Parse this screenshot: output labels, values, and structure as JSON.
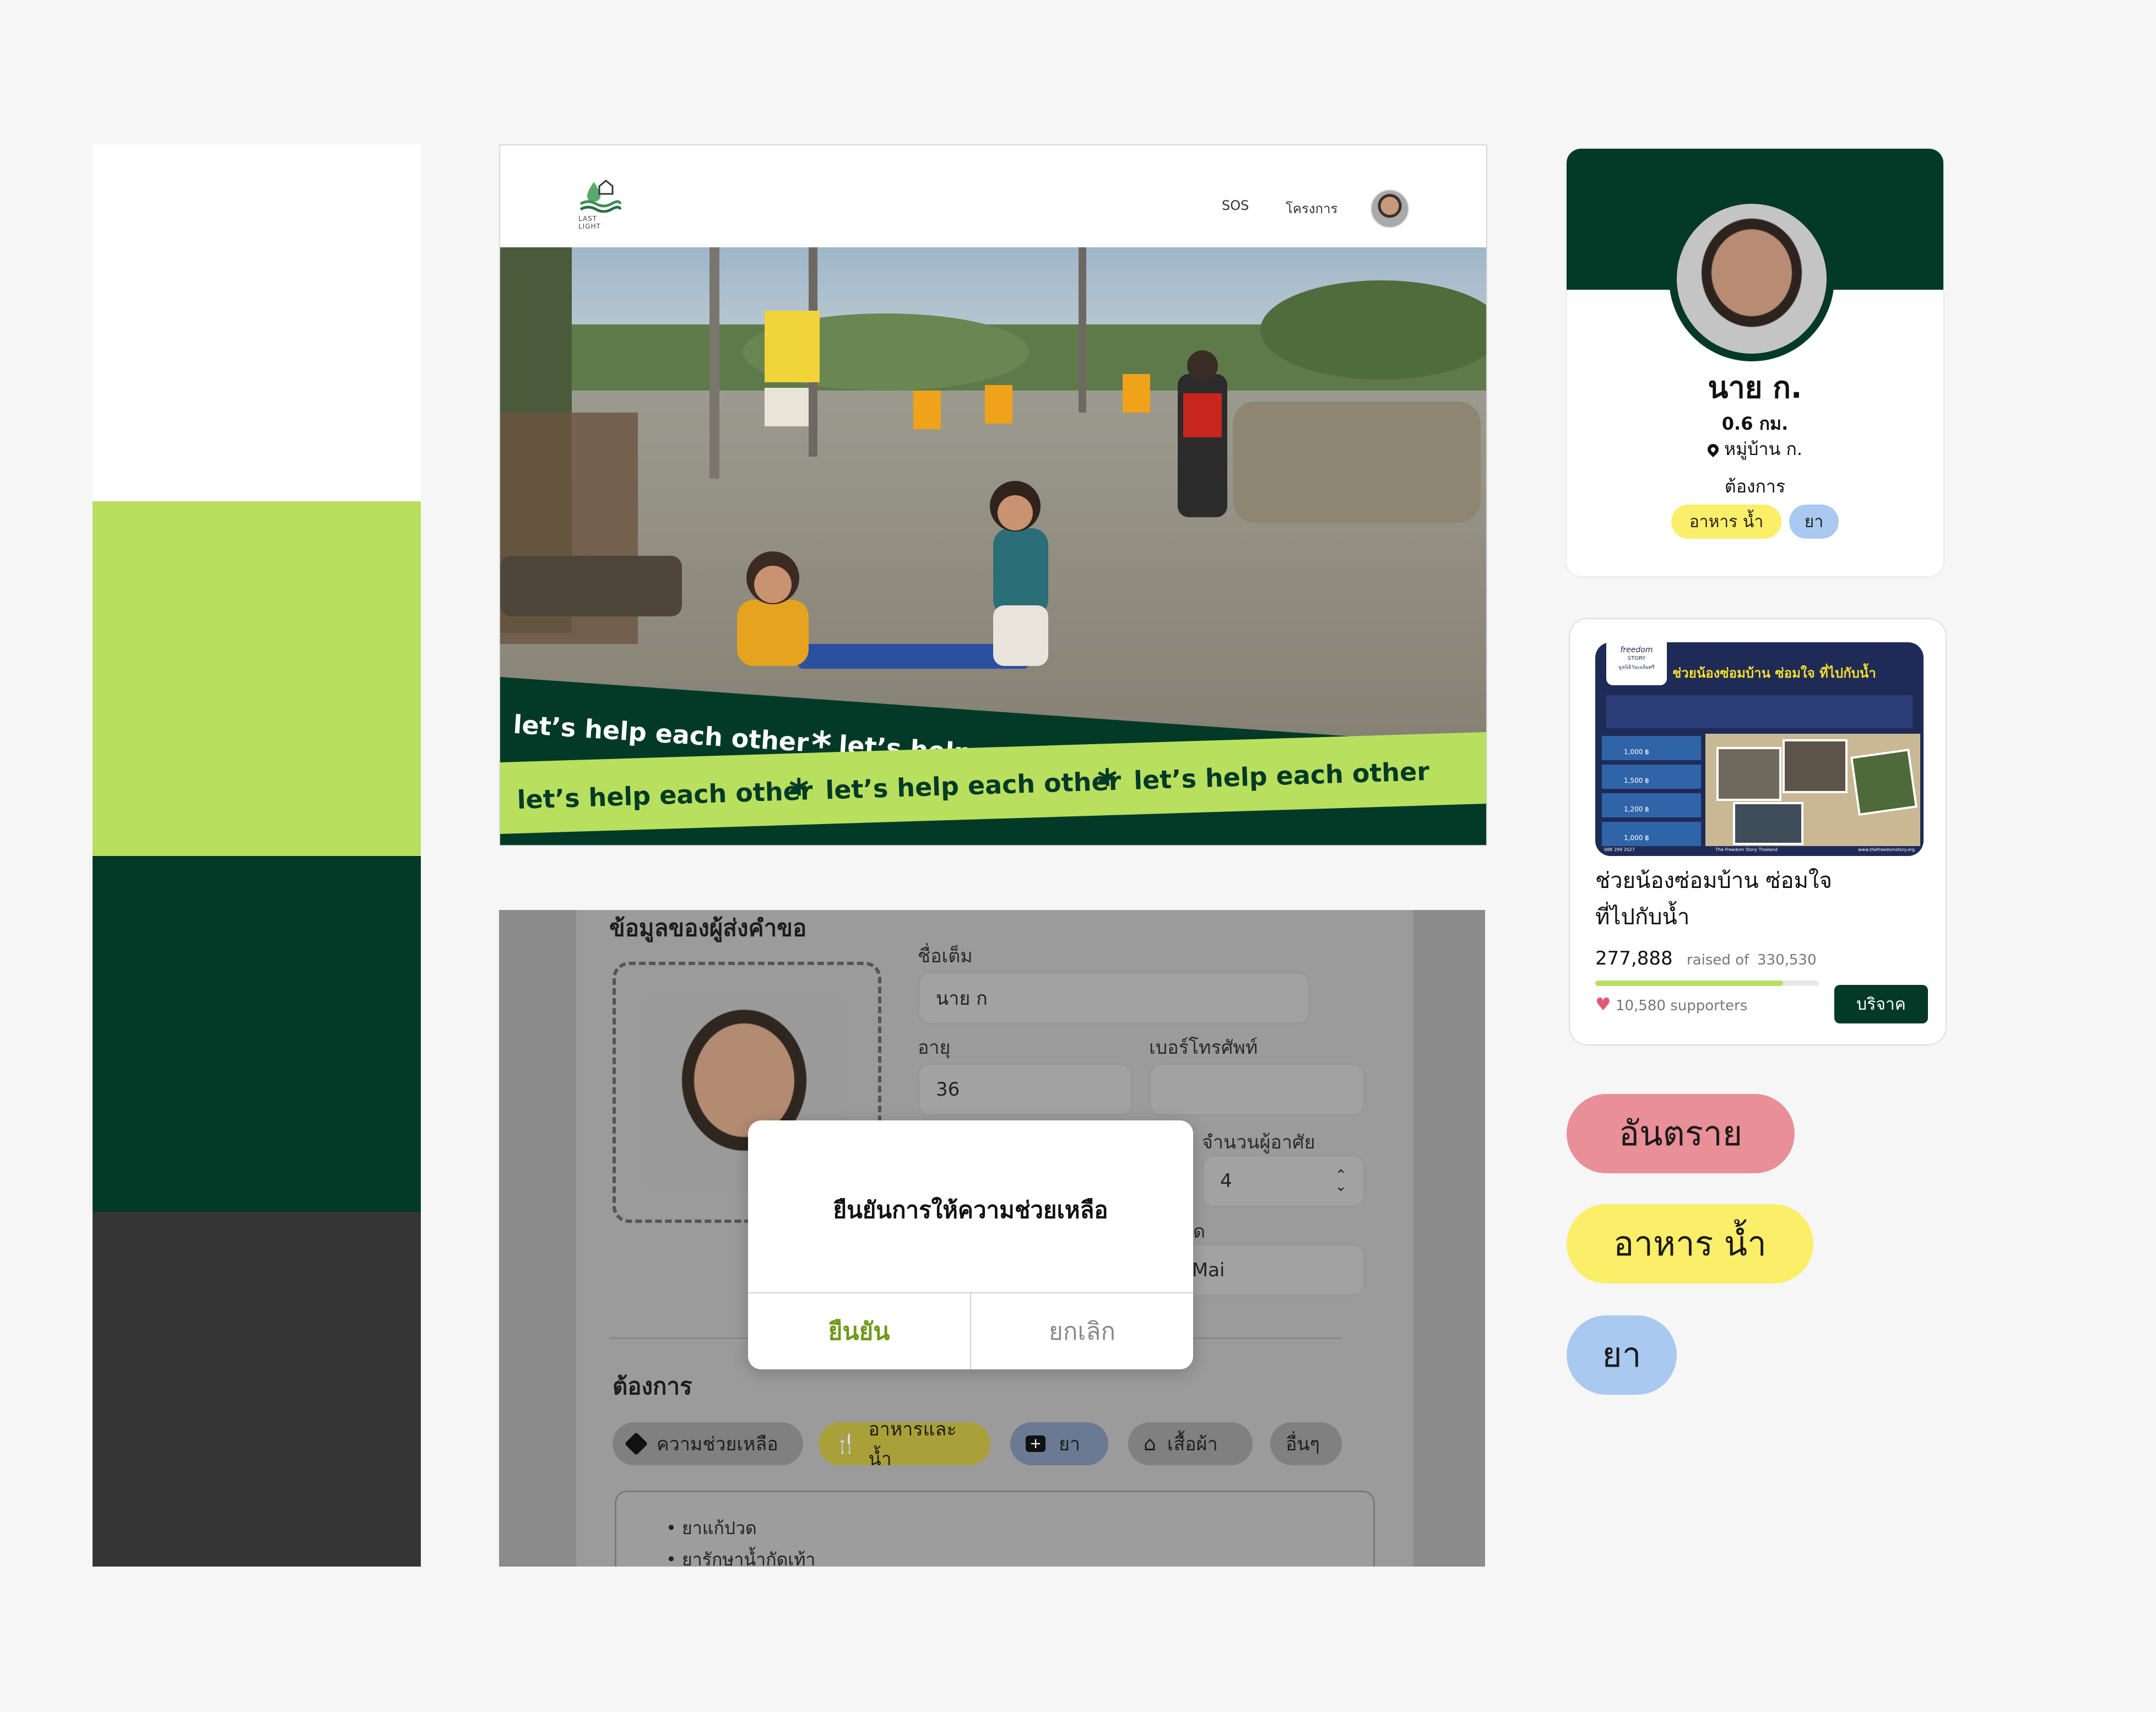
{
  "palette": {
    "white": "#ffffff",
    "lime": "#b9df5f",
    "dark_green": "#023a27",
    "charcoal": "#353535"
  },
  "hero": {
    "logo_text": "LAST LIGHT",
    "nav": {
      "sos": "SOS",
      "projects": "โครงการ"
    },
    "banner_text": "let’s help each other",
    "banner_star": "*"
  },
  "form": {
    "section_title": "ข้อมูลของผู้ส่งคำขอ",
    "fullname_label": "ชื่อเต็ม",
    "fullname_value": "นาย ก",
    "age_label": "อายุ",
    "age_value": "36",
    "phone_label": "เบอร์โทรศัพท์",
    "phone_value": "",
    "residents_label": "จำนวนผู้อาศัย",
    "residents_value": "4",
    "province_label_partial": "ด",
    "province_value_partial": "ang Mai",
    "needs_title": "ต้องการ",
    "needs": [
      {
        "label": "ความช่วยเหลือ",
        "icon": "warning-diamond-icon"
      },
      {
        "label": "อาหารและน้ำ",
        "icon": "fork-knife-icon"
      },
      {
        "label": "ยา",
        "icon": "medkit-icon"
      },
      {
        "label": "เสื้อผ้า",
        "icon": "hanger-icon"
      },
      {
        "label": "อื่นๆ",
        "icon": ""
      }
    ],
    "notes": [
      "ยาแก้ปวด",
      "ยารักษาน้ำกัดเท้า"
    ],
    "dialog": {
      "title": "ยืนยันการให้ความช่วยเหลือ",
      "confirm": "ยืนยัน",
      "cancel": "ยกเลิก"
    }
  },
  "profile": {
    "name": "นาย ก.",
    "distance": "0.6 กม.",
    "location": "หมู่บ้าน ก.",
    "needs_label": "ต้องการ",
    "needs": [
      "อาหาร น้ำ",
      "ยา"
    ]
  },
  "donation": {
    "title_line1": "ช่วยน้องซ่อมบ้าน ซ่อมใจ",
    "title_line2": "ที่ไปกับน้ำ",
    "raised": "277,888",
    "raised_of": "raised of",
    "goal": "330,530",
    "progress_fraction": 0.84,
    "supporters": "10,580 supporters",
    "donate_button": "บริจาค",
    "poster": {
      "brand_top": "freedom",
      "brand_sub": "STORY",
      "foundation": "มูลนิธิวันเฉลิมศรี",
      "headline": "ช่วยน้องซ่อมบ้าน ซ่อมใจ ที่ไปกับน้ำ",
      "amounts": [
        "1,000 ฿",
        "1,500 ฿",
        "1,200 ฿",
        "1,000 ฿"
      ],
      "footer_left": "088 299 2027",
      "footer_mid": "The Freedom Story Thailand",
      "footer_right": "www.thefreedomstory.org"
    }
  },
  "tags": {
    "danger": "อันตราย",
    "food_water": "อาหาร น้ำ",
    "medicine": "ยา"
  },
  "colors": {
    "tag_danger": "#e98f97",
    "tag_food": "#fbee68",
    "tag_medicine": "#a9c9f0",
    "accent_lime": "#b9df5f",
    "accent_dark": "#023a27"
  }
}
